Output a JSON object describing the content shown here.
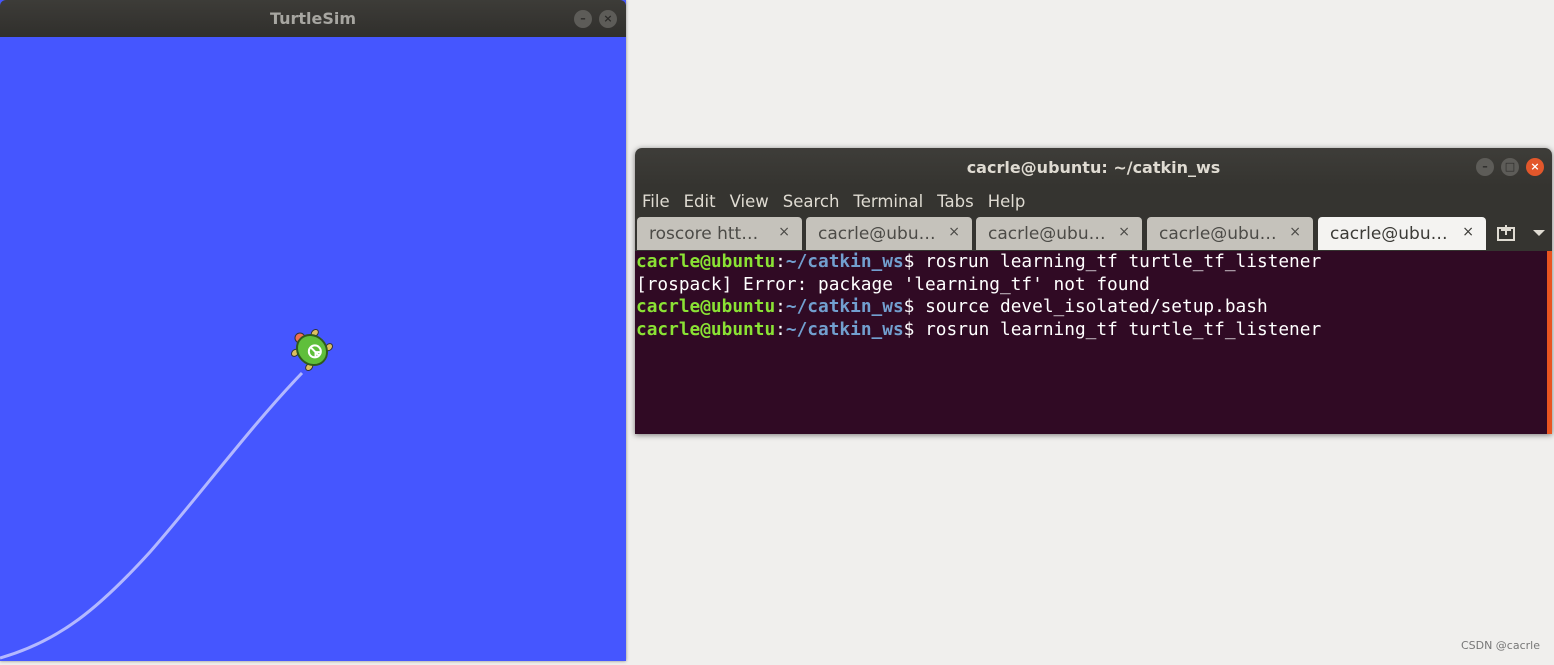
{
  "turtlesim": {
    "title": "TurtleSim",
    "background_color": "#4556ff",
    "trail_color": "#b3b8ff"
  },
  "terminal": {
    "title": "cacrle@ubuntu: ~/catkin_ws",
    "menu": [
      "File",
      "Edit",
      "View",
      "Search",
      "Terminal",
      "Tabs",
      "Help"
    ],
    "tabs": [
      {
        "label": "roscore htt…",
        "active": false
      },
      {
        "label": "cacrle@ubu…",
        "active": false
      },
      {
        "label": "cacrle@ubu…",
        "active": false
      },
      {
        "label": "cacrle@ubu…",
        "active": false
      },
      {
        "label": "cacrle@ubu…",
        "active": true
      }
    ],
    "tab_close_glyph": "×",
    "lines": [
      {
        "user": "cacrle@ubuntu",
        "sep": ":",
        "path": "~/catkin_ws",
        "prompt": "$ ",
        "cmd": "rosrun learning_tf turtle_tf_listener"
      },
      {
        "output": "[rospack] Error: package 'learning_tf' not found"
      },
      {
        "user": "cacrle@ubuntu",
        "sep": ":",
        "path": "~/catkin_ws",
        "prompt": "$ ",
        "cmd": "source devel_isolated/setup.bash"
      },
      {
        "user": "cacrle@ubuntu",
        "sep": ":",
        "path": "~/catkin_ws",
        "prompt": "$ ",
        "cmd": "rosrun learning_tf turtle_tf_listener"
      }
    ],
    "background_color": "#300a24",
    "user_color": "#8ae234",
    "path_color": "#729fcf",
    "accent_color": "#e95420"
  },
  "watermark": "CSDN @cacrle"
}
